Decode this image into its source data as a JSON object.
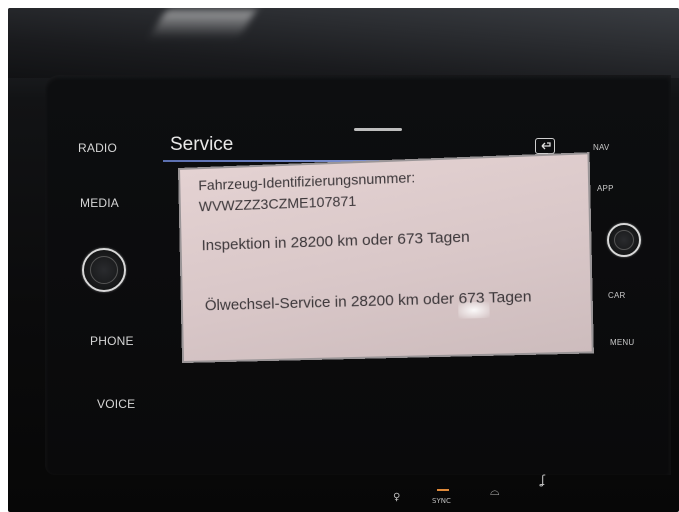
{
  "left_buttons": {
    "radio": "RADIO",
    "media": "MEDIA",
    "phone": "PHONE",
    "voice": "VOICE"
  },
  "right_buttons": {
    "nav": "NAV",
    "app": "APP",
    "car": "CAR",
    "menu": "MENU"
  },
  "screen": {
    "title": "Service",
    "back_icon": "back-arrow-icon",
    "accent_color": "#6f82c4"
  },
  "service_info": {
    "vin_label": "Fahrzeug-Identifizierungsnummer:",
    "vin_value": "WVWZZZ3CZME107871",
    "inspection": "Inspektion in 28200 km oder 673 Tagen",
    "oil_service": "Ölwechsel-Service in 28200 km oder 673 Tagen"
  },
  "bottom_bar": {
    "sync_label": "SYNC",
    "icons": [
      "person-icon",
      "sync-icon",
      "car-icon",
      "seat-heating-icon"
    ]
  }
}
